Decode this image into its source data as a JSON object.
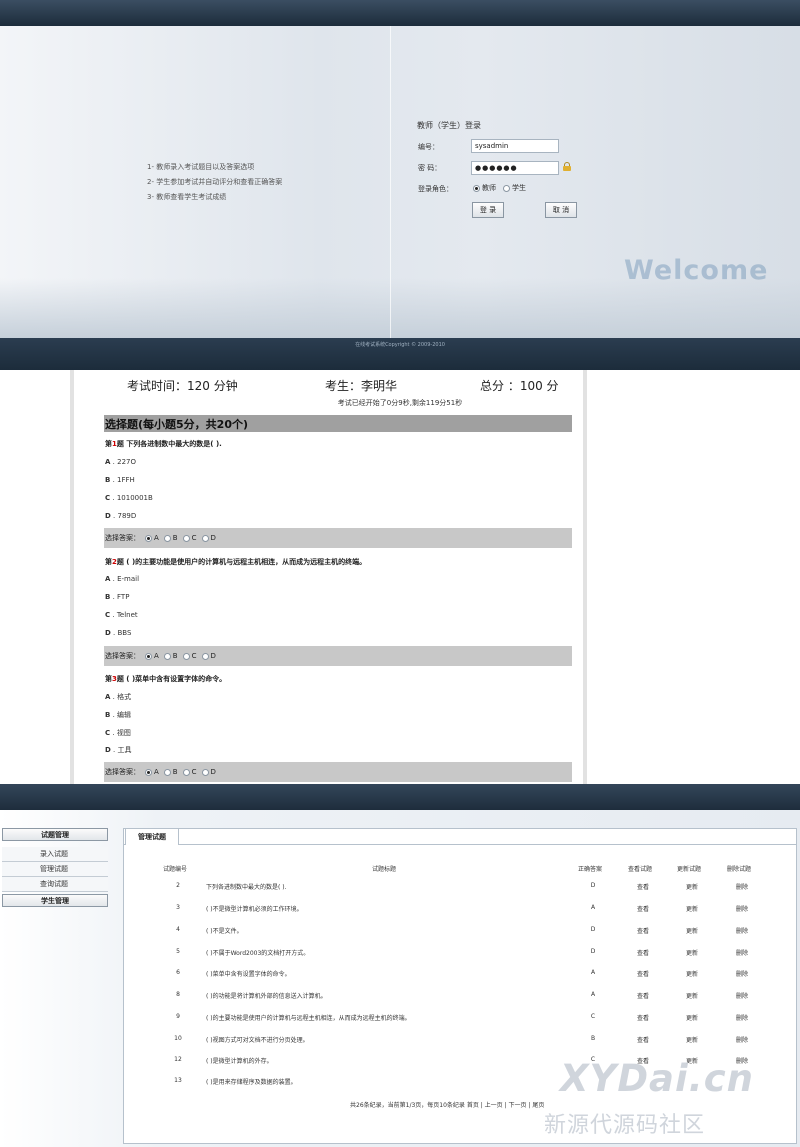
{
  "login": {
    "features": [
      "1- 教师录入考试题目以及答案选项",
      "2- 学生参加考试并自动评分和查看正确答案",
      "3- 教师查看学生考试成绩"
    ],
    "title": "教师（学生）登录",
    "username_label": "编号：",
    "username_value": "sysadmin",
    "password_label": "密 码：",
    "password_value": "●●●●●●",
    "role_label": "登录角色：",
    "role_options": [
      "教师",
      "学生"
    ],
    "role_selected": "教师",
    "login_button": "登 录",
    "cancel_button": "取 消",
    "welcome": "Welcome",
    "footer": "在线考试系统Copyright © 2009-2010"
  },
  "exam": {
    "time_label": "考试时间：120 分钟",
    "student_label": "考生：李明华",
    "total_label": "总分 ：100 分",
    "timer": "考试已经开始了0分9秒,剩余119分51秒",
    "section": "选择题(每小题5分，共20个)",
    "answer_label": "选择答案：",
    "answer_choices": [
      "A",
      "B",
      "C",
      "D"
    ],
    "questions": [
      {
        "prefix": "第",
        "num": "1",
        "suffix": "题 下列各进制数中最大的数是( ).",
        "options": [
          {
            "k": "A",
            "t": "227O"
          },
          {
            "k": "B",
            "t": "1FFH"
          },
          {
            "k": "C",
            "t": "1010001B"
          },
          {
            "k": "D",
            "t": "789D"
          }
        ]
      },
      {
        "prefix": "第",
        "num": "2",
        "suffix": "题 ( )的主要功能是使用户的计算机与远程主机相连，从而成为远程主机的终端。",
        "options": [
          {
            "k": "A",
            "t": "E-mail"
          },
          {
            "k": "B",
            "t": "FTP"
          },
          {
            "k": "C",
            "t": "Telnet"
          },
          {
            "k": "D",
            "t": "BBS"
          }
        ]
      },
      {
        "prefix": "第",
        "num": "3",
        "suffix": "题 ( )菜单中含有设置字体的命令。",
        "options": [
          {
            "k": "A",
            "t": "格式"
          },
          {
            "k": "B",
            "t": "编辑"
          },
          {
            "k": "C",
            "t": "视图"
          },
          {
            "k": "D",
            "t": "工具"
          }
        ]
      }
    ]
  },
  "admin": {
    "sidebar": {
      "group1": "试题管理",
      "items": [
        "录入试题",
        "管理试题",
        "查询试题"
      ],
      "group2": "学生管理"
    },
    "tab": "管理试题",
    "columns": [
      "试题编号",
      "试题标题",
      "正确答案",
      "查看试题",
      "更新试题",
      "删除试题"
    ],
    "rows": [
      {
        "id": "2",
        "title": "下列各进制数中最大的数是( ).",
        "answer": "D",
        "view": "查看",
        "update": "更新",
        "delete": "删除"
      },
      {
        "id": "3",
        "title": "( )不是微型计算机必须的工作环境。",
        "answer": "A",
        "view": "查看",
        "update": "更新",
        "delete": "删除"
      },
      {
        "id": "4",
        "title": "( )不是文件。",
        "answer": "D",
        "view": "查看",
        "update": "更新",
        "delete": "删除"
      },
      {
        "id": "5",
        "title": "( )不属于Word2003的文档打开方式。",
        "answer": "D",
        "view": "查看",
        "update": "更新",
        "delete": "删除"
      },
      {
        "id": "6",
        "title": "( )菜单中含有设置字体的命令。",
        "answer": "A",
        "view": "查看",
        "update": "更新",
        "delete": "删除"
      },
      {
        "id": "8",
        "title": "( )的功能是将计算机外部的信息送入计算机。",
        "answer": "A",
        "view": "查看",
        "update": "更新",
        "delete": "删除"
      },
      {
        "id": "9",
        "title": "( )的主要功能是使用户的计算机与远程主机相连，从而成为远程主机的终端。",
        "answer": "C",
        "view": "查看",
        "update": "更新",
        "delete": "删除"
      },
      {
        "id": "10",
        "title": "( )视图方式可对文档不进行分页处理。",
        "answer": "B",
        "view": "查看",
        "update": "更新",
        "delete": "删除"
      },
      {
        "id": "12",
        "title": "( )是微型计算机的外存。",
        "answer": "C",
        "view": "查看",
        "update": "更新",
        "delete": "删除"
      },
      {
        "id": "13",
        "title": "( )是用来存储程序及数据的装置。",
        "answer": "",
        "view": "",
        "update": "",
        "delete": ""
      }
    ],
    "pager": "共26条纪录，当前第1/3页，每页10条纪录 首页 | 上一页 | 下一页 | 尾页"
  },
  "watermark": {
    "main": "XYDai.cn",
    "sub": "新源代源码社区"
  }
}
